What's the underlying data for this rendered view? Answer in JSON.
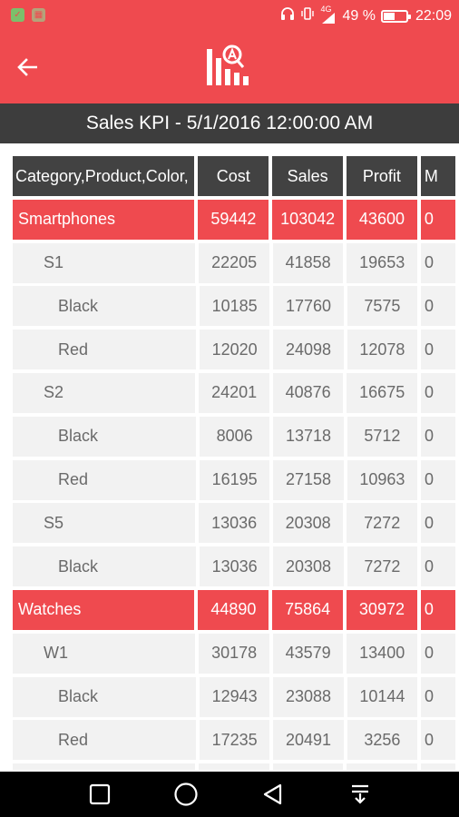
{
  "status_bar": {
    "signal": "4G",
    "battery_percent": "49 %",
    "battery_level": 0.49,
    "time": "22:09"
  },
  "app_bar": {
    "back_icon": "arrow-left-icon",
    "logo_icon": "sales-kpi-logo-icon"
  },
  "title": "Sales KPI - 5/1/2016 12:00:00 AM",
  "table": {
    "headers": [
      "Category,Product,Color,",
      "Cost",
      "Sales",
      "Profit",
      "M"
    ],
    "rows": [
      {
        "level": 0,
        "cells": [
          "Smartphones",
          "59442",
          "103042",
          "43600",
          "0"
        ]
      },
      {
        "level": 1,
        "cells": [
          "S1",
          "22205",
          "41858",
          "19653",
          "0"
        ]
      },
      {
        "level": 2,
        "cells": [
          "Black",
          "10185",
          "17760",
          "7575",
          "0"
        ]
      },
      {
        "level": 2,
        "cells": [
          "Red",
          "12020",
          "24098",
          "12078",
          "0"
        ]
      },
      {
        "level": 1,
        "cells": [
          "S2",
          "24201",
          "40876",
          "16675",
          "0"
        ]
      },
      {
        "level": 2,
        "cells": [
          "Black",
          "8006",
          "13718",
          "5712",
          "0"
        ]
      },
      {
        "level": 2,
        "cells": [
          "Red",
          "16195",
          "27158",
          "10963",
          "0"
        ]
      },
      {
        "level": 1,
        "cells": [
          "S5",
          "13036",
          "20308",
          "7272",
          "0"
        ]
      },
      {
        "level": 2,
        "cells": [
          "Black",
          "13036",
          "20308",
          "7272",
          "0"
        ]
      },
      {
        "level": 0,
        "cells": [
          "Watches",
          "44890",
          "75864",
          "30972",
          "0"
        ]
      },
      {
        "level": 1,
        "cells": [
          "W1",
          "30178",
          "43579",
          "13400",
          "0"
        ]
      },
      {
        "level": 2,
        "cells": [
          "Black",
          "12943",
          "23088",
          "10144",
          "0"
        ]
      },
      {
        "level": 2,
        "cells": [
          "Red",
          "17235",
          "20491",
          "3256",
          "0"
        ]
      },
      {
        "level": 1,
        "cells": [
          "",
          "",
          "",
          "",
          ""
        ]
      }
    ]
  },
  "nav_bar": {
    "buttons": [
      "recents-square-icon",
      "home-circle-icon",
      "back-triangle-icon",
      "notifications-pull-icon"
    ]
  },
  "colors": {
    "accent": "#ef4a4f",
    "header_bg": "#424242",
    "title_bg": "#3d3d3d",
    "cell_bg": "#f2f2f2",
    "text": "#6a6a6a"
  }
}
